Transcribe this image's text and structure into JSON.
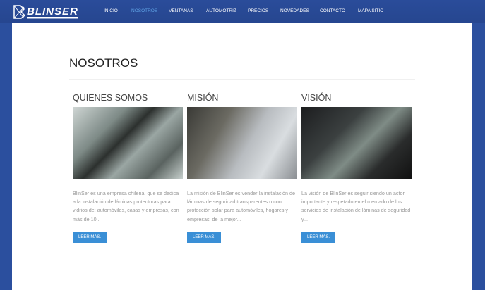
{
  "brand": {
    "name": "BLINSER"
  },
  "nav": [
    {
      "label": "INICIO"
    },
    {
      "label": "NOSOTROS",
      "active": true
    },
    {
      "label": "VENTANAS"
    },
    {
      "label": "AUTOMOTRIZ"
    },
    {
      "label": "PRECIOS"
    },
    {
      "label": "NOVEDADES"
    },
    {
      "label": "CONTACTO"
    },
    {
      "label": "MAPA SITIO"
    }
  ],
  "page": {
    "title": "NOSOTROS"
  },
  "sections": [
    {
      "heading": "QUIENES SOMOS",
      "image": "workers-installing-window-film",
      "text": "BlinSer es una empresa chilena, que se dedica a la instalación de láminas protectoras para vidrios de: automóviles, casas y empresas, con más de 10...",
      "button": "LEER MÁS."
    },
    {
      "heading": "MISIÓN",
      "image": "man-applying-car-window-film",
      "text": "La misión de BlinSer es vender la instalación de láminas de seguridad transparentes o con protección solar para automóviles, hogares y empresas, de la mejor...",
      "button": "LEER MÁS."
    },
    {
      "heading": "VISIÓN",
      "image": "masked-thief-at-car-window",
      "text": "La visión de BlinSer es seguir siendo un actor importante y respetado en el mercado de los servicios de instalación de láminas de seguridad y...",
      "button": "LEER MÁS."
    }
  ],
  "colors": {
    "background": "#2b4f9e",
    "active_nav": "#5fa3e6",
    "button": "#3a8fd6"
  }
}
